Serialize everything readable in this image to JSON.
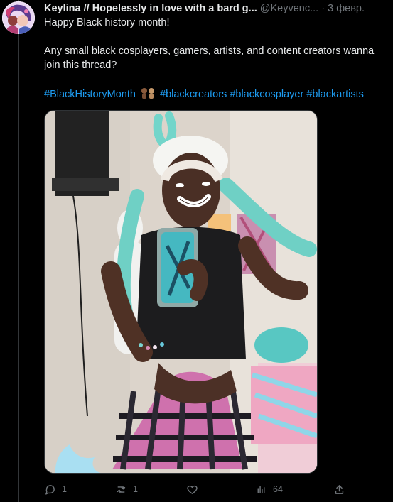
{
  "tweet": {
    "display_name": "Keylina // Hopelessly in love with a bard g...",
    "handle": "@Keyvenc...",
    "separator": "·",
    "date": "3 февр.",
    "lines": [
      "Happy Black history month!",
      "",
      "Any small black cosplayers, gamers, artists, and content creators wanna",
      "join this thread?",
      ""
    ],
    "hashtags": {
      "first": "#BlackHistoryMonth",
      "rest": "#blackcreators #blackcosplayer #blackartists"
    }
  },
  "actions": {
    "reply_count": "1",
    "retweet_count": "1",
    "view_count": "64"
  },
  "icons": {
    "emoji": "raised-fists-emoji",
    "reply": "reply-icon",
    "retweet": "retweet-icon",
    "like": "heart-icon",
    "views": "views-icon",
    "share": "share-icon"
  },
  "colors": {
    "background": "#000000",
    "text": "#e7e9ea",
    "secondary": "#71767b",
    "link": "#1d9bf0",
    "thread_line": "#333639"
  }
}
